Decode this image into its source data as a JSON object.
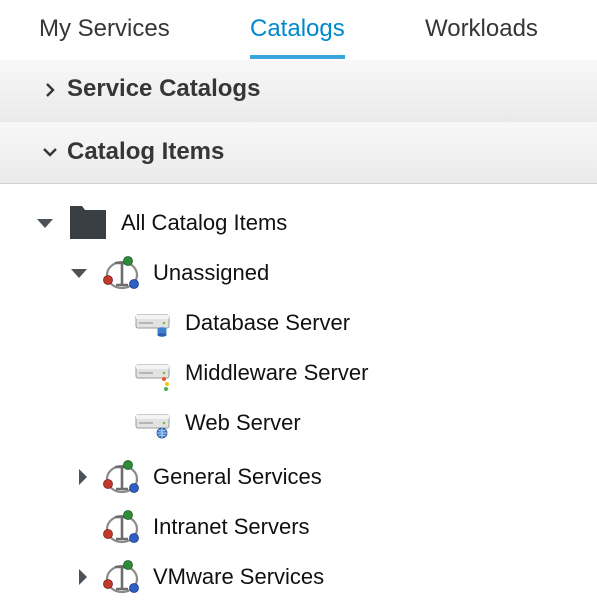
{
  "tabs": [
    {
      "label": "My Services",
      "active": false
    },
    {
      "label": "Catalogs",
      "active": true
    },
    {
      "label": "Workloads",
      "active": false
    }
  ],
  "accordions": [
    {
      "label": "Service Catalogs",
      "expanded": false
    },
    {
      "label": "Catalog Items",
      "expanded": true
    }
  ],
  "tree": {
    "root": {
      "label": "All Catalog Items",
      "icon": "folder-icon",
      "expanded": true
    },
    "catalogs": [
      {
        "label": "Unassigned",
        "icon": "catalog-icon",
        "expanded": true,
        "items": [
          {
            "label": "Database Server",
            "icon": "server-database-icon"
          },
          {
            "label": "Middleware Server",
            "icon": "server-middleware-icon"
          },
          {
            "label": "Web Server",
            "icon": "server-web-icon"
          }
        ]
      },
      {
        "label": "General Services",
        "icon": "catalog-icon",
        "expanded": false
      },
      {
        "label": "Intranet Servers",
        "icon": "catalog-icon",
        "expanded": false
      },
      {
        "label": "VMware Services",
        "icon": "catalog-icon",
        "expanded": false
      }
    ]
  },
  "colors": {
    "active_tab": "#0088ce",
    "tab_underline": "#39a5dc",
    "text": "#363636",
    "folder": "#3a3f44"
  }
}
